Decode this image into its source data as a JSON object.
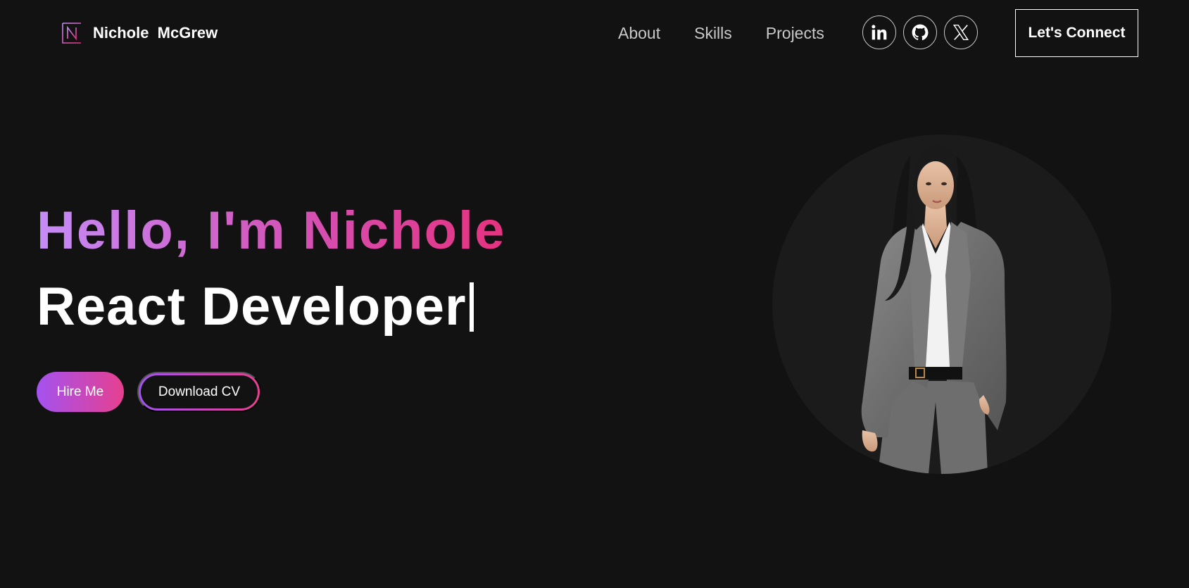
{
  "nav": {
    "brand_name": "Nichole  McGrew",
    "links": [
      "About",
      "Skills",
      "Projects"
    ],
    "socials": [
      "linkedin-icon",
      "github-icon",
      "x-icon"
    ],
    "cta_label": "Let's Connect"
  },
  "hero": {
    "greeting": "Hello, I'm Nichole",
    "role": "React Developer",
    "primary_button": "Hire Me",
    "secondary_button": "Download CV"
  },
  "colors": {
    "background": "#121212",
    "gradient_start": "#c58cf7",
    "gradient_end": "#e5327f",
    "button_gradient_start": "#a452f0",
    "button_gradient_end": "#e6408f",
    "text": "#ffffff",
    "nav_link": "#c9c9c9"
  }
}
